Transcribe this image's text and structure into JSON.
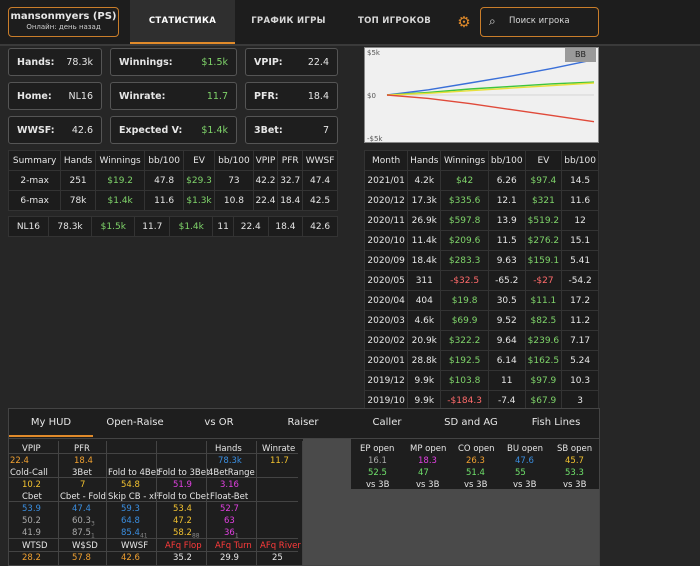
{
  "profile": {
    "name": "mansonmyers (PS)",
    "status": "Онлайн: день назад"
  },
  "nav": {
    "tabs": [
      "СТАТИСТИКА",
      "ГРАФИК ИГРЫ",
      "ТОП ИГРОКОВ"
    ],
    "search_placeholder": "Поиск игрока"
  },
  "stats": {
    "hands": {
      "label": "Hands:",
      "value": "78.3k"
    },
    "winnings": {
      "label": "Winnings:",
      "value": "$1.5k"
    },
    "vpip": {
      "label": "VPIP:",
      "value": "22.4"
    },
    "home": {
      "label": "Home:",
      "value": "NL16"
    },
    "winrate": {
      "label": "Winrate:",
      "value": "11.7"
    },
    "pfr": {
      "label": "PFR:",
      "value": "18.4"
    },
    "wwsf": {
      "label": "WWSF:",
      "value": "42.6"
    },
    "expected": {
      "label": "Expected V:",
      "value": "$1.4k"
    },
    "bet3": {
      "label": "3Bet:",
      "value": "7"
    }
  },
  "chart": {
    "badge": "BB",
    "ticks": [
      "$5k",
      "$0",
      "-$5k"
    ],
    "colors": {
      "blue": "#3a6fd8",
      "green": "#3ec43e",
      "yellow": "#e8e03a",
      "red": "#e04a3a"
    }
  },
  "chart_data": {
    "type": "line",
    "ylim": [
      -5000,
      5000
    ],
    "ticks": [
      "$5k",
      "$0",
      "-$5k"
    ],
    "series": [
      {
        "values": [
          0,
          600,
          1400,
          2200,
          3100,
          4100
        ]
      },
      {
        "values": [
          0,
          300,
          700,
          1000,
          1300,
          1500
        ]
      },
      {
        "values": [
          0,
          200,
          500,
          800,
          1100,
          1400
        ]
      },
      {
        "values": [
          0,
          -400,
          -1000,
          -1700,
          -2400,
          -3100
        ]
      }
    ]
  },
  "summary": {
    "headers": [
      "Summary",
      "Hands",
      "Winnings",
      "bb/100",
      "EV",
      "bb/100",
      "VPIP",
      "PFR",
      "WWSF"
    ],
    "rows": [
      [
        "2-max",
        "251",
        "$19.2",
        "47.8",
        "$29.3",
        "73",
        "42.2",
        "32.7",
        "47.4"
      ],
      [
        "6-max",
        "78k",
        "$1.4k",
        "11.6",
        "$1.3k",
        "10.8",
        "22.4",
        "18.4",
        "42.5"
      ]
    ],
    "total": [
      "NL16",
      "78.3k",
      "$1.5k",
      "11.7",
      "$1.4k",
      "11",
      "22.4",
      "18.4",
      "42.6"
    ]
  },
  "months": {
    "headers": [
      "Month",
      "Hands",
      "Winnings",
      "bb/100",
      "EV",
      "bb/100"
    ],
    "rows": [
      [
        "2021/01",
        "4.2k",
        "$42",
        "6.26",
        "$97.4",
        "14.5"
      ],
      [
        "2020/12",
        "17.3k",
        "$335.6",
        "12.1",
        "$321",
        "11.6"
      ],
      [
        "2020/11",
        "26.9k",
        "$597.8",
        "13.9",
        "$519.2",
        "12"
      ],
      [
        "2020/10",
        "11.4k",
        "$209.6",
        "11.5",
        "$276.2",
        "15.1"
      ],
      [
        "2020/09",
        "18.4k",
        "$283.3",
        "9.63",
        "$159.1",
        "5.41"
      ],
      [
        "2020/05",
        "311",
        "-$32.5",
        "-65.2",
        "-$27",
        "-54.2"
      ],
      [
        "2020/04",
        "404",
        "$19.8",
        "30.5",
        "$11.1",
        "17.2"
      ],
      [
        "2020/03",
        "4.6k",
        "$69.9",
        "9.52",
        "$82.5",
        "11.2"
      ],
      [
        "2020/02",
        "20.9k",
        "$322.2",
        "9.64",
        "$239.6",
        "7.17"
      ],
      [
        "2020/01",
        "28.8k",
        "$192.5",
        "6.14",
        "$162.5",
        "5.24"
      ],
      [
        "2019/12",
        "9.9k",
        "$103.8",
        "11",
        "$97.9",
        "10.3"
      ],
      [
        "2019/10",
        "9.9k",
        "-$184.3",
        "-7.4",
        "$67.9",
        "3"
      ]
    ]
  },
  "hud": {
    "tabs": [
      "My HUD",
      "Open-Raise",
      "vs OR",
      "Raiser",
      "Caller",
      "SD and AG",
      "Fish Lines"
    ],
    "r1": {
      "vpip": "VPIP",
      "vpip_v": "22.4",
      "pfr": "PFR",
      "pfr_v": "18.4",
      "hands": "Hands",
      "hands_v": "78.3k",
      "winrate": "Winrate",
      "winrate_v": "11.7"
    },
    "r2": {
      "cc": "Cold-Call",
      "cc_v": "10.2",
      "b3": "3Bet",
      "b3_v": "7",
      "f4": "Fold to 4Bet",
      "f4_v": "54.8",
      "f3": "Fold to 3Bet",
      "f3_v": "51.9",
      "r4": "4BetRange",
      "r4_v": "3.16"
    },
    "r3": {
      "cbet": "Cbet",
      "cbf": "Cbet - Fold",
      "skip": "Skip CB - xF",
      "fcb": "Fold to Cbet",
      "fb": "Float-Bet",
      "a1": "53.9",
      "a2": "47.4",
      "a3": "59.3",
      "a4": "53.4",
      "a5": "52.7",
      "b1": "50.2",
      "b2": "60.3",
      "b3": "64.8",
      "b4": "47.2",
      "b5": "63",
      "c1": "41.9",
      "c2": "87.5",
      "c3": "85.4",
      "c4": "58.2",
      "c5": "36",
      "b2s": "3",
      "c2s": "1",
      "c3s": "41",
      "c4s": "88",
      "c5s": "1"
    },
    "r4": {
      "wtsd": "WTSD",
      "wsd": "W$SD",
      "wwsf": "WWSF",
      "afqf": "AFq Flop",
      "afqt": "AFq Turn",
      "afqr": "AFq River",
      "v1": "28.2",
      "v2": "57.8",
      "v3": "42.6",
      "v4": "35.2",
      "v5": "29.9",
      "v6": "25"
    },
    "pos": {
      "headers": [
        "EP open",
        "MP open",
        "CO open",
        "BU open",
        "SB open"
      ],
      "vals": [
        "16.1",
        "18.3",
        "26.3",
        "47.6",
        "45.7"
      ],
      "vs": [
        "52.5",
        "47",
        "51.4",
        "55",
        "53.3"
      ],
      "vs3b": "vs 3B"
    }
  }
}
